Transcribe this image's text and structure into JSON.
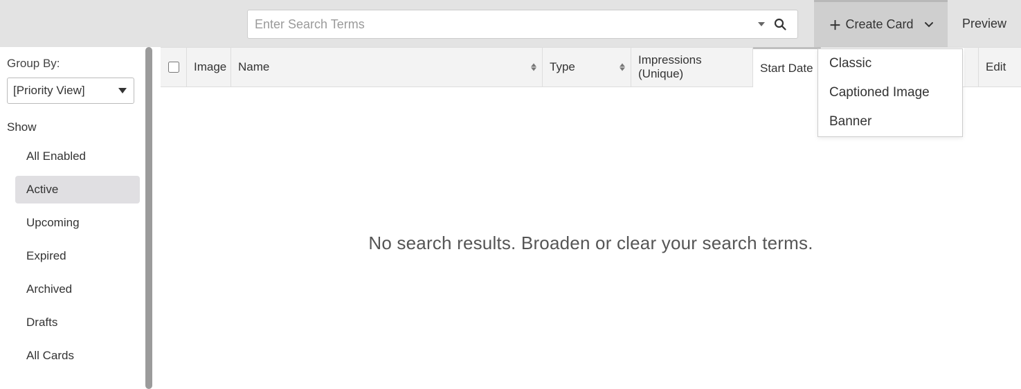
{
  "topbar": {
    "search_placeholder": "Enter Search Terms",
    "create_card_label": "Create Card",
    "preview_label": "Preview"
  },
  "create_menu": {
    "items": [
      "Classic",
      "Captioned Image",
      "Banner"
    ]
  },
  "sidebar": {
    "group_by_label": "Group By:",
    "group_by_value": "[Priority View]",
    "show_label": "Show",
    "items": [
      {
        "label": "All Enabled",
        "active": false
      },
      {
        "label": "Active",
        "active": true
      },
      {
        "label": "Upcoming",
        "active": false
      },
      {
        "label": "Expired",
        "active": false
      },
      {
        "label": "Archived",
        "active": false
      },
      {
        "label": "Drafts",
        "active": false
      },
      {
        "label": "All Cards",
        "active": false
      }
    ]
  },
  "table": {
    "columns": {
      "image": "Image",
      "name": "Name",
      "type": "Type",
      "impressions": "Impressions (Unique)",
      "start_date": "Start Date",
      "edit": "Edit"
    },
    "empty_message": "No search results. Broaden or clear your search terms."
  }
}
